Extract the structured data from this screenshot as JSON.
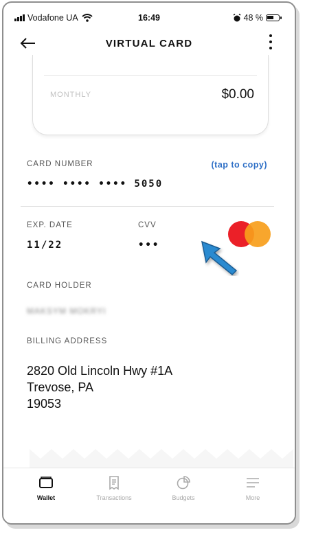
{
  "status_bar": {
    "carrier": "Vodafone UA",
    "time": "16:49",
    "battery": "48 %"
  },
  "header": {
    "title": "VIRTUAL CARD"
  },
  "balance": {
    "label": "MONTHLY",
    "value": "$0.00"
  },
  "card": {
    "number_label": "CARD NUMBER",
    "copy_label": "(tap to copy)",
    "number": "•••• •••• •••• 5050",
    "exp_label": "EXP. DATE",
    "exp_value": "11/22",
    "cvv_label": "CVV",
    "cvv_value": "•••",
    "holder_label": "CARD HOLDER",
    "holder_value": "MAKSYM MOKRYI",
    "billing_label": "BILLING ADDRESS",
    "billing_line1": "2820 Old Lincoln Hwy #1A",
    "billing_line2": "Trevose, PA",
    "billing_line3": "19053"
  },
  "tabs": [
    {
      "label": "Wallet",
      "icon": "wallet-icon",
      "active": true
    },
    {
      "label": "Transactions",
      "icon": "receipt-icon",
      "active": false
    },
    {
      "label": "Budgets",
      "icon": "pie-chart-icon",
      "active": false
    },
    {
      "label": "More",
      "icon": "menu-icon",
      "active": false
    }
  ],
  "colors": {
    "accent": "#2e6fc6",
    "mastercard_red": "#eb2028",
    "mastercard_orange": "#f79e1b",
    "pointer": "#2a8ad0"
  }
}
